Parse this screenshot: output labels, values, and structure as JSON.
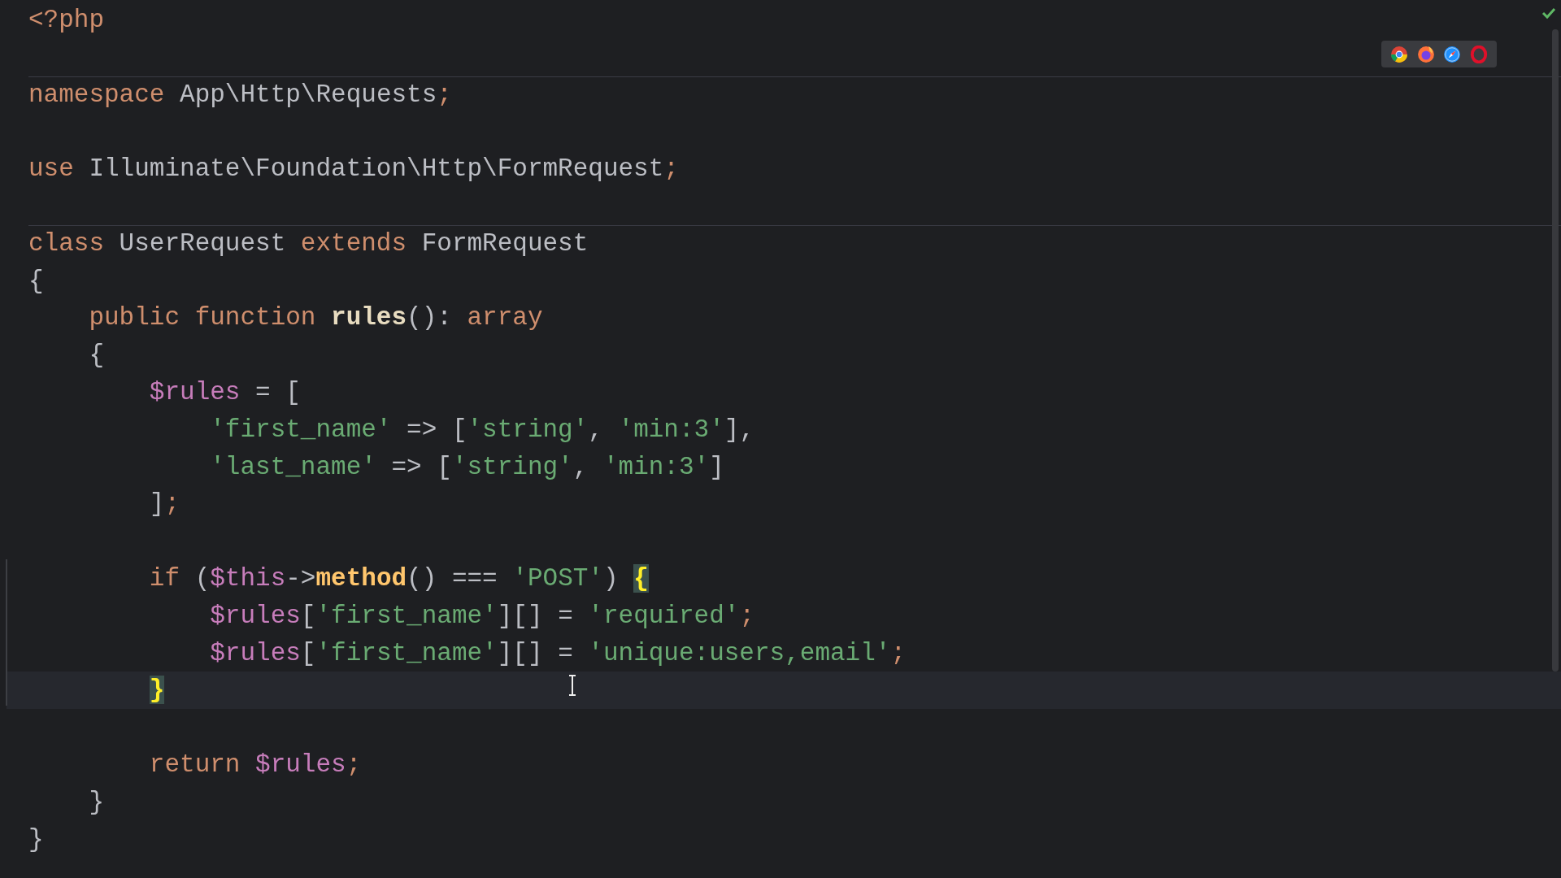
{
  "editor": {
    "lines": [
      {
        "current": false,
        "divider_above": false,
        "tokens": [
          {
            "kind": "keyword",
            "text": "<?php"
          }
        ]
      },
      {
        "current": false,
        "divider_above": false
      },
      {
        "current": false,
        "divider_above": true,
        "tokens": [
          {
            "kind": "keyword",
            "text": "namespace"
          },
          {
            "kind": "plain",
            "text": " App\\Http\\Requests"
          },
          {
            "kind": "keyword",
            "text": ";"
          }
        ]
      },
      {
        "current": false,
        "divider_above": false
      },
      {
        "current": false,
        "divider_above": false,
        "tokens": [
          {
            "kind": "keyword",
            "text": "use"
          },
          {
            "kind": "plain",
            "text": " Illuminate\\Foundation\\Http\\FormRequest"
          },
          {
            "kind": "keyword",
            "text": ";"
          }
        ]
      },
      {
        "current": false,
        "divider_above": false
      },
      {
        "current": false,
        "divider_above": true,
        "tokens": [
          {
            "kind": "keyword",
            "text": "class"
          },
          {
            "kind": "plain",
            "text": " UserRequest "
          },
          {
            "kind": "keyword",
            "text": "extends"
          },
          {
            "kind": "plain",
            "text": " FormRequest"
          }
        ]
      },
      {
        "current": false,
        "divider_above": false,
        "tokens": [
          {
            "kind": "plain",
            "text": "{"
          }
        ]
      },
      {
        "current": false,
        "divider_above": false,
        "tokens": [
          {
            "kind": "keyword",
            "text": "    public function "
          },
          {
            "kind": "function",
            "text": "rules"
          },
          {
            "kind": "plain",
            "text": "(): "
          },
          {
            "kind": "keyword",
            "text": "array"
          }
        ]
      },
      {
        "current": false,
        "divider_above": false,
        "tokens": [
          {
            "kind": "plain",
            "text": "    {"
          }
        ]
      },
      {
        "current": false,
        "divider_above": false,
        "tokens": [
          {
            "kind": "variable",
            "text": "        $rules"
          },
          {
            "kind": "plain",
            "text": " = ["
          }
        ]
      },
      {
        "current": false,
        "divider_above": false,
        "tokens": [
          {
            "kind": "string",
            "text": "            'first_name'"
          },
          {
            "kind": "plain",
            "text": " => ["
          },
          {
            "kind": "string",
            "text": "'string'"
          },
          {
            "kind": "plain",
            "text": ", "
          },
          {
            "kind": "string",
            "text": "'min:3'"
          },
          {
            "kind": "plain",
            "text": "],"
          }
        ]
      },
      {
        "current": false,
        "divider_above": false,
        "tokens": [
          {
            "kind": "string",
            "text": "            'last_name'"
          },
          {
            "kind": "plain",
            "text": " => ["
          },
          {
            "kind": "string",
            "text": "'string'"
          },
          {
            "kind": "plain",
            "text": ", "
          },
          {
            "kind": "string",
            "text": "'min:3'"
          },
          {
            "kind": "plain",
            "text": "]"
          }
        ]
      },
      {
        "current": false,
        "divider_above": false,
        "tokens": [
          {
            "kind": "plain",
            "text": "        ]"
          },
          {
            "kind": "keyword",
            "text": ";"
          }
        ]
      },
      {
        "current": false,
        "divider_above": false
      },
      {
        "current": false,
        "divider_above": false,
        "tokens": [
          {
            "kind": "keyword",
            "text": "        if"
          },
          {
            "kind": "plain",
            "text": " ("
          },
          {
            "kind": "variable",
            "text": "$this"
          },
          {
            "kind": "plain",
            "text": "->"
          },
          {
            "kind": "method",
            "text": "method"
          },
          {
            "kind": "plain",
            "text": "() === "
          },
          {
            "kind": "string",
            "text": "'POST'"
          },
          {
            "kind": "plain",
            "text": ") "
          },
          {
            "kind": "brace",
            "text": "{"
          }
        ]
      },
      {
        "current": false,
        "divider_above": false,
        "tokens": [
          {
            "kind": "variable",
            "text": "            $rules"
          },
          {
            "kind": "plain",
            "text": "["
          },
          {
            "kind": "string",
            "text": "'first_name'"
          },
          {
            "kind": "plain",
            "text": "][] = "
          },
          {
            "kind": "string",
            "text": "'required'"
          },
          {
            "kind": "keyword",
            "text": ";"
          }
        ]
      },
      {
        "current": false,
        "divider_above": false,
        "tokens": [
          {
            "kind": "variable",
            "text": "            $rules"
          },
          {
            "kind": "plain",
            "text": "["
          },
          {
            "kind": "string",
            "text": "'first_name'"
          },
          {
            "kind": "plain",
            "text": "][] = "
          },
          {
            "kind": "string",
            "text": "'unique:users,email'"
          },
          {
            "kind": "keyword",
            "text": ";"
          }
        ]
      },
      {
        "current": true,
        "divider_above": false,
        "tokens": [
          {
            "kind": "brace",
            "text": "        }"
          }
        ]
      },
      {
        "current": false,
        "divider_above": false
      },
      {
        "current": false,
        "divider_above": false,
        "tokens": [
          {
            "kind": "keyword",
            "text": "        return"
          },
          {
            "kind": "variable",
            "text": " $rules"
          },
          {
            "kind": "keyword",
            "text": ";"
          }
        ]
      },
      {
        "current": false,
        "divider_above": false,
        "tokens": [
          {
            "kind": "plain",
            "text": "    }"
          }
        ]
      },
      {
        "current": false,
        "divider_above": false,
        "tokens": [
          {
            "kind": "plain",
            "text": "}"
          }
        ]
      }
    ]
  }
}
